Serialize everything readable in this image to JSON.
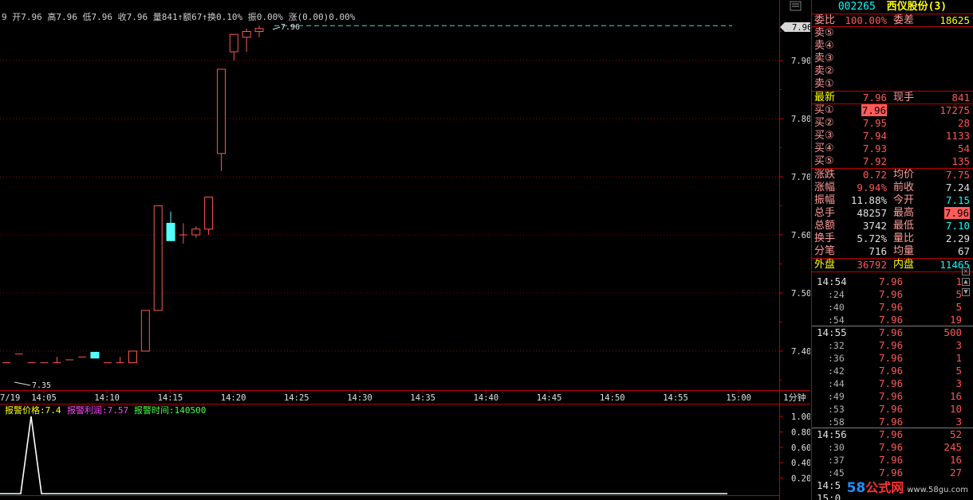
{
  "header_line": "9 开7.96 高7.96 低7.96 收7.96 量841↑额67↑换0.10% 振0.00% 涨(0.00)0.00%",
  "price_axis": {
    "current_tag": "7.96",
    "ticks": [
      "7.90",
      "7.80",
      "7.70",
      "7.60",
      "7.50",
      "7.40"
    ]
  },
  "time_axis": {
    "date": "7/19",
    "labels": [
      "14:05",
      "14:10",
      "14:15",
      "14:20",
      "14:25",
      "14:30",
      "14:35",
      "14:40",
      "14:45",
      "14:50",
      "14:55",
      "15:00"
    ],
    "period": "1分钟"
  },
  "annotations": {
    "high": "7.96",
    "low": "7.35"
  },
  "indicator": {
    "alarm_price_label": "报警价格:7.4",
    "alarm_profit_label": "报警利润:7.57",
    "alarm_time_label": "报警时间:140500",
    "ticks": [
      "1.00",
      "0.80",
      "0.60",
      "0.40",
      "0.20"
    ]
  },
  "candles": [
    {
      "o": 7.38,
      "c": 7.38,
      "h": 7.38,
      "l": 7.38
    },
    {
      "o": 7.395,
      "c": 7.395,
      "h": 7.395,
      "l": 7.395
    },
    {
      "o": 7.38,
      "c": 7.38,
      "h": 7.38,
      "l": 7.38
    },
    {
      "o": 7.38,
      "c": 7.38,
      "h": 7.38,
      "l": 7.38
    },
    {
      "o": 7.38,
      "c": 7.38,
      "h": 7.39,
      "l": 7.38
    },
    {
      "o": 7.385,
      "c": 7.385,
      "h": 7.385,
      "l": 7.385
    },
    {
      "o": 7.39,
      "c": 7.39,
      "h": 7.39,
      "l": 7.39
    },
    {
      "o": 7.398,
      "c": 7.388,
      "h": 7.398,
      "l": 7.388
    },
    {
      "o": 7.38,
      "c": 7.38,
      "h": 7.38,
      "l": 7.38
    },
    {
      "o": 7.38,
      "c": 7.38,
      "h": 7.39,
      "l": 7.38
    },
    {
      "o": 7.38,
      "c": 7.4,
      "h": 7.4,
      "l": 7.38
    },
    {
      "o": 7.4,
      "c": 7.47,
      "h": 7.47,
      "l": 7.4
    },
    {
      "o": 7.47,
      "c": 7.65,
      "h": 7.65,
      "l": 7.47
    },
    {
      "o": 7.62,
      "c": 7.59,
      "h": 7.64,
      "l": 7.59
    },
    {
      "o": 7.6,
      "c": 7.6,
      "h": 7.62,
      "l": 7.585
    },
    {
      "o": 7.6,
      "c": 7.61,
      "h": 7.615,
      "l": 7.595
    },
    {
      "o": 7.61,
      "c": 7.665,
      "h": 7.665,
      "l": 7.6
    },
    {
      "o": 7.74,
      "c": 7.885,
      "h": 7.885,
      "l": 7.71
    },
    {
      "o": 7.915,
      "c": 7.945,
      "h": 7.945,
      "l": 7.9
    },
    {
      "o": 7.94,
      "c": 7.95,
      "h": 7.955,
      "l": 7.915
    },
    {
      "o": 7.95,
      "c": 7.955,
      "h": 7.96,
      "l": 7.94
    }
  ],
  "stock": {
    "code": "002265",
    "name": "西仪股份(3)"
  },
  "quote": {
    "wb_label": "委比",
    "wb_value": "100.00%",
    "wc_label": "委差",
    "wc_value": "18625",
    "asks": [
      {
        "label": "卖⑤",
        "price": "",
        "vol": ""
      },
      {
        "label": "卖④",
        "price": "",
        "vol": ""
      },
      {
        "label": "卖③",
        "price": "",
        "vol": ""
      },
      {
        "label": "卖②",
        "price": "",
        "vol": ""
      },
      {
        "label": "卖①",
        "price": "",
        "vol": ""
      }
    ],
    "last_label": "最新",
    "last_value": "7.96",
    "cur_label": "现手",
    "cur_value": "841",
    "bids": [
      {
        "label": "买①",
        "price": "7.96",
        "vol": "17275"
      },
      {
        "label": "买②",
        "price": "7.95",
        "vol": "28"
      },
      {
        "label": "买③",
        "price": "7.94",
        "vol": "1133"
      },
      {
        "label": "买④",
        "price": "7.93",
        "vol": "54"
      },
      {
        "label": "买⑤",
        "price": "7.92",
        "vol": "135"
      }
    ],
    "stats": [
      {
        "l1": "涨跌",
        "v1": "0.72",
        "c1": "red",
        "l2": "均价",
        "v2": "7.75",
        "c2": "red"
      },
      {
        "l1": "涨幅",
        "v1": "9.94%",
        "c1": "red",
        "l2": "前收",
        "v2": "7.24",
        "c2": "wht"
      },
      {
        "l1": "振幅",
        "v1": "11.88%",
        "c1": "wht",
        "l2": "今开",
        "v2": "7.15",
        "c2": "cya"
      },
      {
        "l1": "总手",
        "v1": "48257",
        "c1": "wht",
        "l2": "最高",
        "v2": "7.96",
        "c2": "hl"
      },
      {
        "l1": "总额",
        "v1": "3742",
        "c1": "wht",
        "l2": "最低",
        "v2": "7.10",
        "c2": "cya"
      },
      {
        "l1": "换手",
        "v1": "5.72%",
        "c1": "wht",
        "l2": "量比",
        "v2": "2.29",
        "c2": "wht"
      },
      {
        "l1": "分笔",
        "v1": "716",
        "c1": "wht",
        "l2": "均量",
        "v2": "67",
        "c2": "wht"
      }
    ],
    "outer_label": "外盘",
    "outer_value": "36792",
    "inner_label": "内盘",
    "inner_value": "11465"
  },
  "ticks": [
    {
      "time": "14:54",
      "sub": false,
      "price": "7.96",
      "vol": "1"
    },
    {
      "time": ":24",
      "sub": true,
      "price": "7.96",
      "vol": "5"
    },
    {
      "time": ":40",
      "sub": true,
      "price": "7.96",
      "vol": "5"
    },
    {
      "time": ":54",
      "sub": true,
      "price": "7.96",
      "vol": "19"
    },
    {
      "time": "14:55",
      "sub": false,
      "price": "7.96",
      "vol": "500"
    },
    {
      "time": ":32",
      "sub": true,
      "price": "7.96",
      "vol": "3"
    },
    {
      "time": ":36",
      "sub": true,
      "price": "7.96",
      "vol": "1"
    },
    {
      "time": ":42",
      "sub": true,
      "price": "7.96",
      "vol": "5"
    },
    {
      "time": ":44",
      "sub": true,
      "price": "7.96",
      "vol": "3"
    },
    {
      "time": ":49",
      "sub": true,
      "price": "7.96",
      "vol": "16"
    },
    {
      "time": ":53",
      "sub": true,
      "price": "7.96",
      "vol": "10"
    },
    {
      "time": ":58",
      "sub": true,
      "price": "7.96",
      "vol": "3"
    },
    {
      "time": "14:56",
      "sub": false,
      "price": "7.96",
      "vol": "52"
    },
    {
      "time": ":30",
      "sub": true,
      "price": "7.96",
      "vol": "245"
    },
    {
      "time": ":37",
      "sub": true,
      "price": "7.96",
      "vol": "16"
    },
    {
      "time": ":45",
      "sub": true,
      "price": "7.96",
      "vol": "27"
    },
    {
      "time": "14:5",
      "sub": false,
      "price": "",
      "vol": ""
    },
    {
      "time": "15:0",
      "sub": false,
      "price": "",
      "vol": ""
    }
  ],
  "watermark": {
    "big": "58",
    "cn": "公式网",
    "url": "www.58gu.com"
  },
  "colors": {
    "up": "#ff5555",
    "down": "#55ffff",
    "grid": "#8b0000",
    "border": "#c00000"
  }
}
